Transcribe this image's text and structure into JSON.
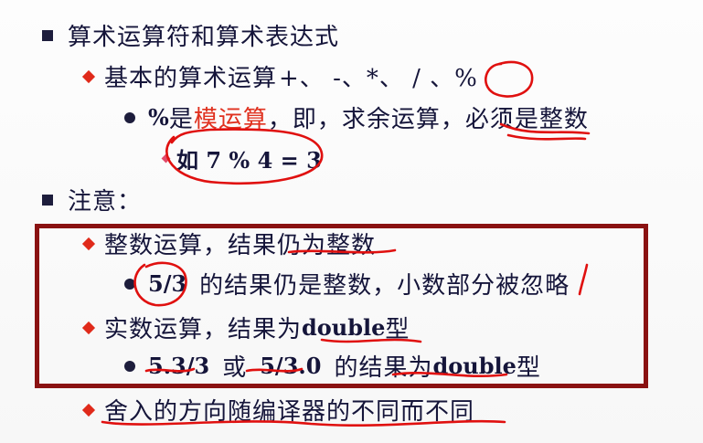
{
  "slide": {
    "heading1": "算术运算符和算术表达式",
    "item1": {
      "label": "基本的算术运算",
      "ops": "+、 -、*、 / 、%"
    },
    "item1_sub": {
      "pct": "%",
      "is": " 是",
      "mod": "模运算",
      "rest": "，即，求余运算，必须是整数"
    },
    "item1_example": "如 7 % 4 = 3",
    "heading2": "注意：",
    "note1": "整数运算，结果仍为整数",
    "note1_sub_value": "5/3",
    "note1_sub_rest": "的结果仍是整数，小数部分被忽略",
    "note2_prefix": "实数运算，结果为",
    "note2_type": "double",
    "note2_suffix": "型",
    "note2_sub_a": "5.3/3",
    "note2_sub_or": "或",
    "note2_sub_b": "5/3.0",
    "note2_sub_rest": "的结果为",
    "note2_sub_type": "double",
    "note2_sub_suffix": "型",
    "note3": "舍入的方向随编译器的不同而不同"
  },
  "annotations": {
    "box_color": "#8a1212",
    "ink_color": "#e0100f",
    "handwritten_mark": "1"
  }
}
